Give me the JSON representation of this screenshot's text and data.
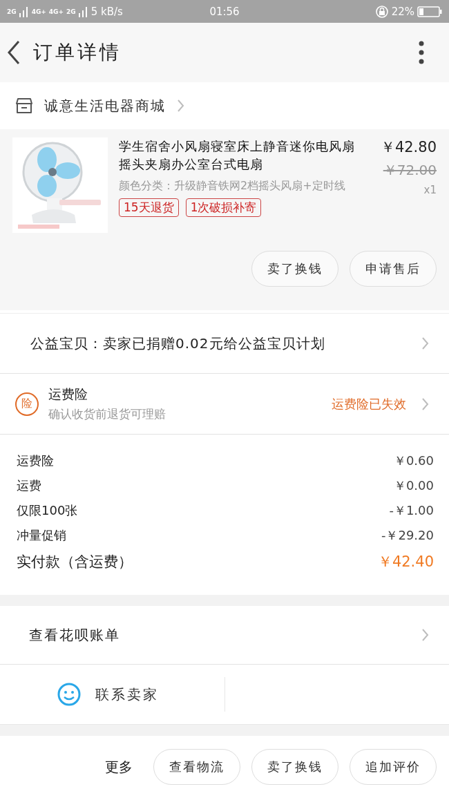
{
  "status_bar": {
    "network_labels": [
      "2G",
      "4G+",
      "4G+",
      "2G"
    ],
    "speed": "5 kB/s",
    "time": "01:56",
    "battery": "22%"
  },
  "header": {
    "title": "订单详情"
  },
  "shop": {
    "name": "诚意生活电器商城"
  },
  "product": {
    "image": {
      "kind": "picture"
    },
    "title": "学生宿舍小风扇寝室床上静音迷你电风扇摇头夹扇办公室台式电扇",
    "variant": "颜色分类：升级静音铁网2档摇头风扇+定时线",
    "price": "￥42.80",
    "original_price": "￥72.00",
    "quantity": "x1",
    "tags": [
      "15天退货",
      "1次破损补寄"
    ],
    "buttons": [
      "卖了换钱",
      "申请售后"
    ]
  },
  "charity": {
    "text": "公益宝贝：卖家已捐赠0.02元给公益宝贝计划"
  },
  "insurance": {
    "icon_label": "险",
    "title": "运费险",
    "subtitle": "确认收货前退货可理赔",
    "status": "运费险已失效"
  },
  "price_lines": [
    {
      "label": "运费险",
      "value": "￥0.60",
      "kind": "normal"
    },
    {
      "label": "运费",
      "value": "￥0.00",
      "kind": "normal"
    },
    {
      "label": "仅限100张",
      "value": "-￥1.00",
      "kind": "normal"
    },
    {
      "label": "冲量促销",
      "value": "-￥29.20",
      "kind": "normal"
    },
    {
      "label": "实付款（含运费）",
      "value": "￥42.40",
      "kind": "total"
    }
  ],
  "huabei": {
    "text": "查看花呗账单"
  },
  "contact": {
    "label": "联系卖家"
  },
  "bottom_bar": {
    "more": "更多",
    "buttons": [
      "查看物流",
      "卖了换钱",
      "追加评价"
    ]
  }
}
